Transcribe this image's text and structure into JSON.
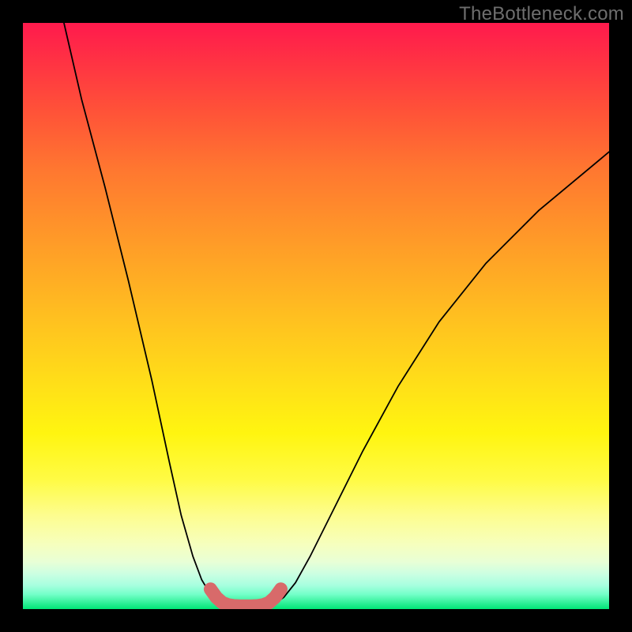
{
  "watermark": "TheBottleneck.com",
  "chart_data": {
    "type": "line",
    "title": "",
    "xlabel": "",
    "ylabel": "",
    "xlim": [
      0,
      100
    ],
    "ylim": [
      0,
      100
    ],
    "grid": false,
    "legend": false,
    "series": [
      {
        "name": "left-curve",
        "style": "solid-black",
        "x": [
          7,
          10,
          14,
          18,
          22,
          25,
          27,
          29,
          30.5,
          32,
          33,
          34,
          35
        ],
        "y": [
          100,
          87,
          72,
          56,
          39,
          25,
          16,
          9,
          5,
          2.5,
          1.4,
          0.9,
          0.7
        ]
      },
      {
        "name": "right-curve",
        "style": "solid-black",
        "x": [
          42,
          43,
          44.5,
          46.5,
          49,
          53,
          58,
          64,
          71,
          79,
          88,
          100
        ],
        "y": [
          0.7,
          1.0,
          2.0,
          4.5,
          9,
          17,
          27,
          38,
          49,
          59,
          68,
          78
        ]
      },
      {
        "name": "valley-band",
        "style": "thick-salmon",
        "x": [
          32,
          33,
          34,
          35,
          36,
          37,
          38,
          39,
          40,
          41,
          42,
          43,
          44
        ],
        "y": [
          3.4,
          2.0,
          1.1,
          0.7,
          0.55,
          0.5,
          0.5,
          0.5,
          0.55,
          0.7,
          1.1,
          2.0,
          3.4
        ]
      }
    ],
    "colors": {
      "curve_stroke": "#000000",
      "band_stroke": "#d86a6a",
      "gradient_top": "#ff1a4d",
      "gradient_bottom": "#00e676"
    }
  }
}
